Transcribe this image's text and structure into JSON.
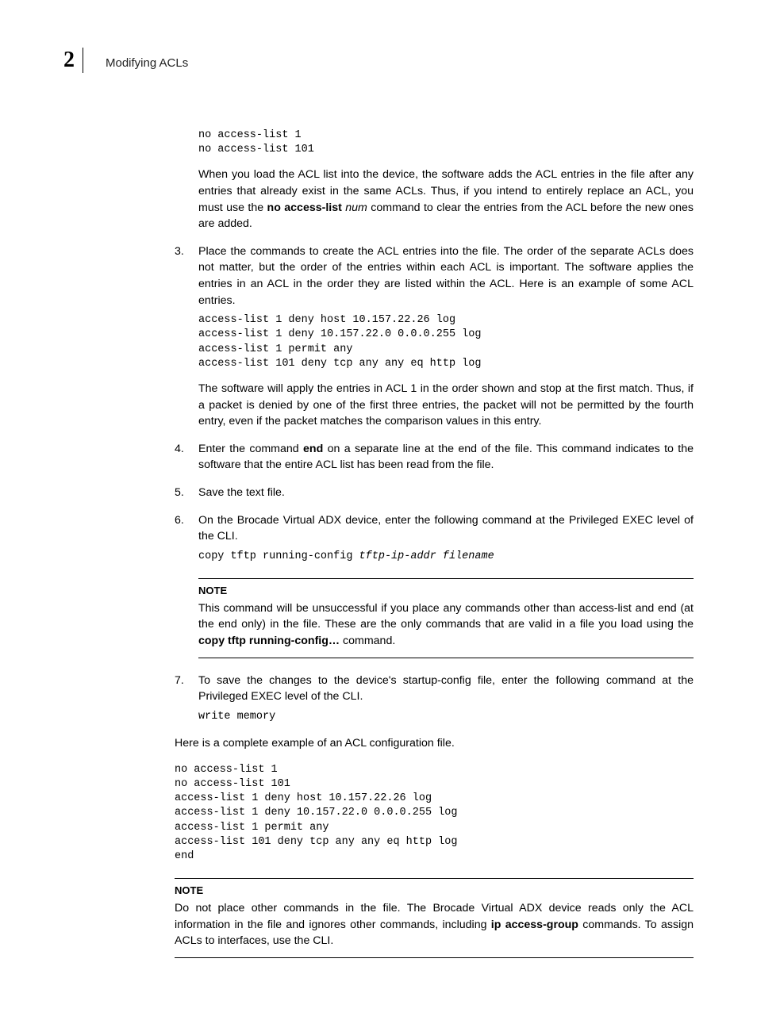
{
  "header": {
    "chapter_number": "2",
    "section_title": "Modifying ACLs"
  },
  "pre_code1": "no access-list 1\nno access-list 101",
  "para1_a": "When you load the ACL list into the device, the software adds the ACL entries in the file after any entries that already exist in the same ACLs. Thus, if you intend to entirely replace an ACL, you must use the ",
  "para1_b": "no access-list",
  "para1_c": " num",
  "para1_d": " command to clear the entries from the ACL before the new ones are added.",
  "step3_num": "3.",
  "step3_text": "Place the commands to create the ACL entries into the file. The order of the separate ACLs does not matter, but the order of the entries within each ACL is important. The software applies the entries in an ACL in the order they are listed within the ACL. Here is an example of some ACL entries.",
  "code2": "access-list 1 deny host 10.157.22.26 log\naccess-list 1 deny 10.157.22.0 0.0.0.255 log\naccess-list 1 permit any \naccess-list 101 deny tcp any any eq http log",
  "para2": "The software will apply the entries in ACL 1 in the order shown and stop at the first match. Thus, if a packet is denied by one of the first three entries, the packet will not be permitted by the fourth entry, even if the packet matches the comparison values in this entry.",
  "step4_num": "4.",
  "step4_a": "Enter the command ",
  "step4_b": "end",
  "step4_c": " on a separate line at the end of the file. This command indicates to the software that the entire ACL list has been read from the file.",
  "step5_num": "5.",
  "step5_text": "Save the text file.",
  "step6_num": "6.",
  "step6_text": "On the Brocade Virtual ADX  device, enter the following command at the Privileged EXEC level of the CLI.",
  "code3_a": "copy tftp running-config ",
  "code3_b": "tftp-ip-addr filename",
  "note1_title": "NOTE",
  "note1_a": "This command will be unsuccessful if you place any commands other than access-list and end (at the end only) in the file. These are the only commands that are valid in a file you load using the ",
  "note1_b": "copy tftp running-config…",
  "note1_c": " command.",
  "step7_num": "7.",
  "step7_text": "To save the changes to the device's startup-config file, enter the following command at the Privileged EXEC level of the CLI.",
  "code4": "write memory",
  "para3": "Here is a complete example of an ACL configuration file.",
  "code5": "no access-list 1\nno access-list 101\naccess-list 1 deny host 10.157.22.26 log\naccess-list 1 deny 10.157.22.0 0.0.0.255 log\naccess-list 1 permit any \naccess-list 101 deny tcp any any eq http log\nend",
  "note2_title": "NOTE",
  "note2_a": "Do not place other commands in the file. The Brocade Virtual ADX  device reads only the ACL information in the file and ignores other commands, including ",
  "note2_b": "ip access-group",
  "note2_c": " commands. To assign ACLs to interfaces, use the CLI."
}
